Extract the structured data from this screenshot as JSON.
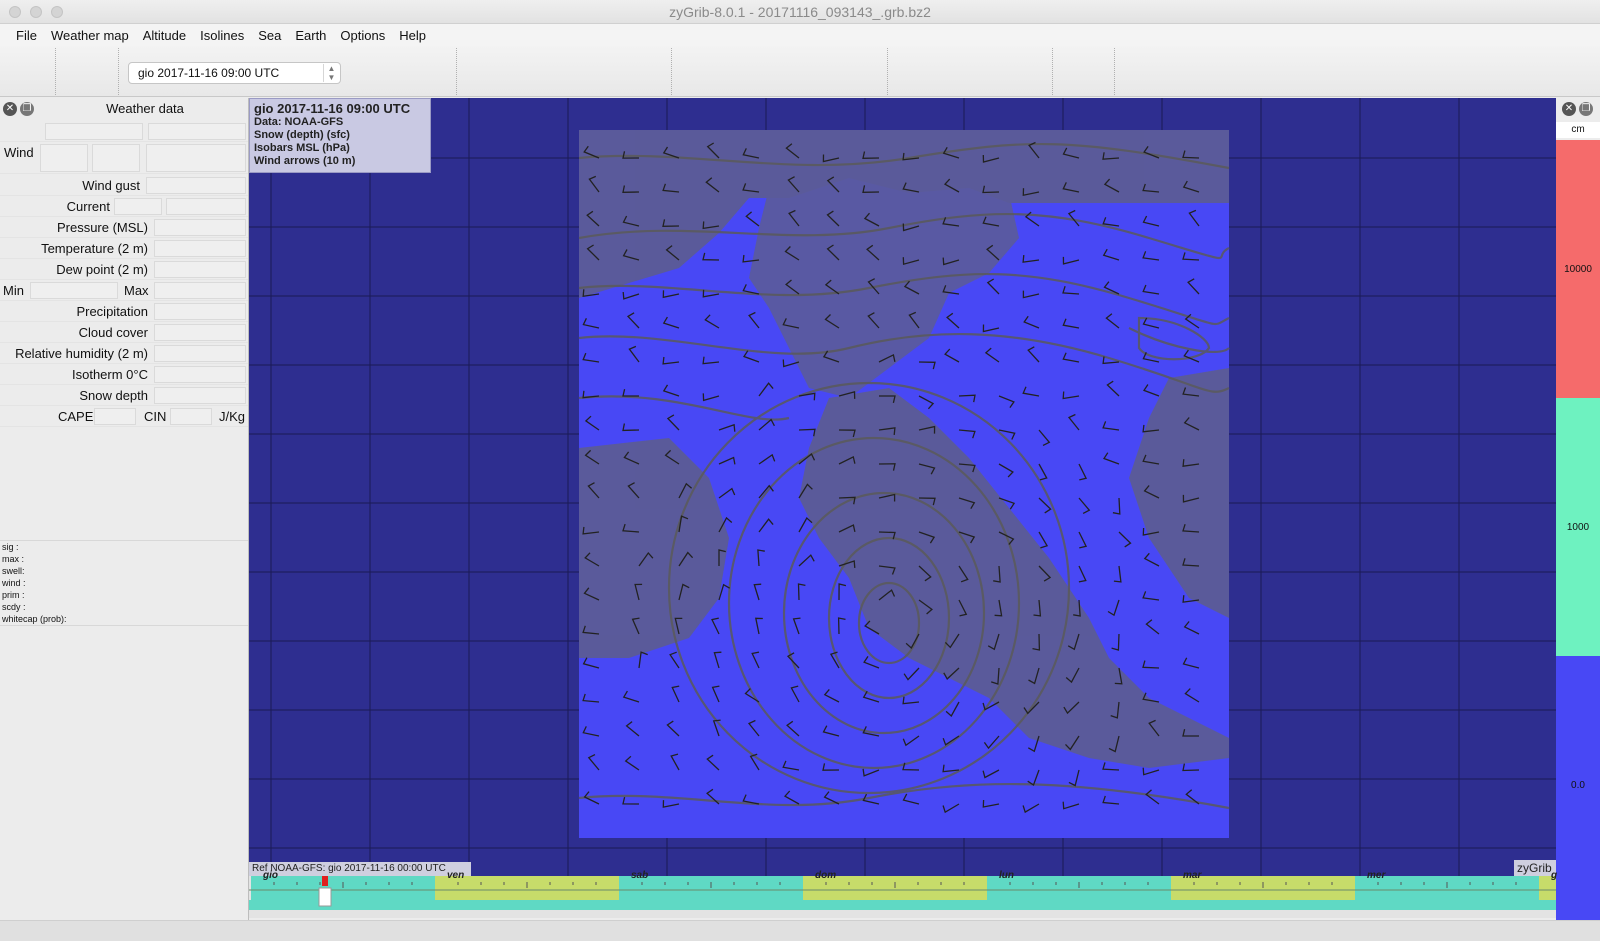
{
  "window": {
    "title": "zyGrib-8.0.1 - 20171116_093143_.grb.bz2"
  },
  "menu": [
    "File",
    "Weather map",
    "Altitude",
    "Isolines",
    "Sea",
    "Earth",
    "Options",
    "Help"
  ],
  "toolbar": {
    "date_value": "gio 2017-11-16 09:00 UTC"
  },
  "panel": {
    "title": "Weather data",
    "wind_label": "Wind",
    "wind_gust": "Wind gust",
    "current": "Current",
    "pressure": "Pressure (MSL)",
    "temperature": "Temperature (2 m)",
    "dew_point": "Dew point (2 m)",
    "min": "Min",
    "max": "Max",
    "precipitation": "Precipitation",
    "cloud_cover": "Cloud cover",
    "humidity": "Relative humidity (2 m)",
    "isotherm": "Isotherm 0°C",
    "snow_depth": "Snow depth",
    "cape": "CAPE",
    "cin": "CIN",
    "cape_unit": "J/Kg",
    "sea_info": [
      "sig  :",
      "max  :",
      "swell:",
      "wind :",
      "prim :",
      "scdy :",
      "whitecap (prob):"
    ]
  },
  "map": {
    "legend_date": "gio 2017-11-16 09:00 UTC",
    "legend_lines": [
      "Data: NOAA-GFS",
      "Snow (depth) (sfc)",
      "Isobars MSL (hPa)",
      "Wind arrows (10 m)"
    ],
    "ref": "Ref NOAA-GFS: gio 2017-11-16 00:00 UTC",
    "brand": "zyGrib",
    "colors": {
      "ocean": "#2e2e90",
      "data_area": "#4848f5",
      "land": "#5c5c96",
      "isobar": "#5a5a5a"
    }
  },
  "scale": {
    "unit": "cm",
    "bands": [
      {
        "label": "10000",
        "color": "#f56b6b"
      },
      {
        "label": "1000",
        "color": "#6ef2c0"
      },
      {
        "label": "0.0",
        "color": "#4848f5"
      }
    ]
  },
  "timeline": {
    "days": [
      "gio",
      "ven",
      "sab",
      "dom",
      "lun",
      "mar",
      "mer",
      "g"
    ],
    "colors": [
      "#5fd9c4",
      "#c7dc6a"
    ]
  }
}
